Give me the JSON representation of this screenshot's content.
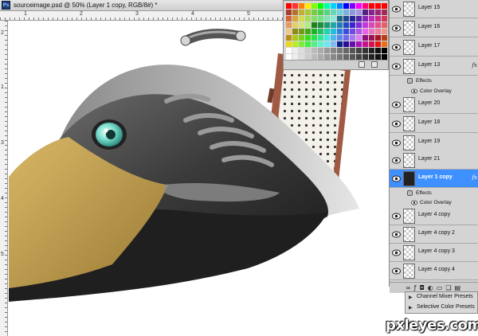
{
  "document": {
    "tab_title": "sourceimage.psd @ 50% (Layer 1 copy, RGB/8#) *",
    "app_icon": "Ps"
  },
  "rulers": {
    "top_marks": [
      "1",
      "2",
      "3",
      "4",
      "5"
    ],
    "left_marks": [
      "2",
      "1",
      "3",
      "4",
      "5"
    ]
  },
  "layers": {
    "rows": [
      {
        "name": "Layer 15",
        "selected": false
      },
      {
        "name": "Layer 16",
        "selected": false
      },
      {
        "name": "Layer 17",
        "selected": false
      },
      {
        "name": "Layer 13",
        "selected": false,
        "fx": "fx"
      },
      {
        "name": "Layer 20",
        "selected": false
      },
      {
        "name": "Layer 18",
        "selected": false
      },
      {
        "name": "Layer 19",
        "selected": false
      },
      {
        "name": "Layer 21",
        "selected": false
      },
      {
        "name": "Layer 1 copy",
        "selected": true,
        "fx": "fx"
      },
      {
        "name": "Layer 4 copy",
        "selected": false
      },
      {
        "name": "Layer 4 copy 2",
        "selected": false
      },
      {
        "name": "Layer 4 copy 3",
        "selected": false
      },
      {
        "name": "Layer 4 copy 4",
        "selected": false
      }
    ],
    "effects_label": "Effects",
    "color_overlay_label": "Color Overlay",
    "footer_icons": [
      "link-icon",
      "fx-icon",
      "mask-icon",
      "adjustment-icon",
      "folder-icon",
      "new-layer-icon",
      "trash-icon"
    ]
  },
  "adjustments": {
    "items": [
      "Channel Mixer Presets",
      "Selective Color Presets"
    ]
  },
  "watermark": "pxleyes.com",
  "colors": {
    "panel_bg": "#d4d4d4",
    "selection": "#3f90ff",
    "beak": "#c9a555",
    "eye": "#7fe0d0"
  }
}
